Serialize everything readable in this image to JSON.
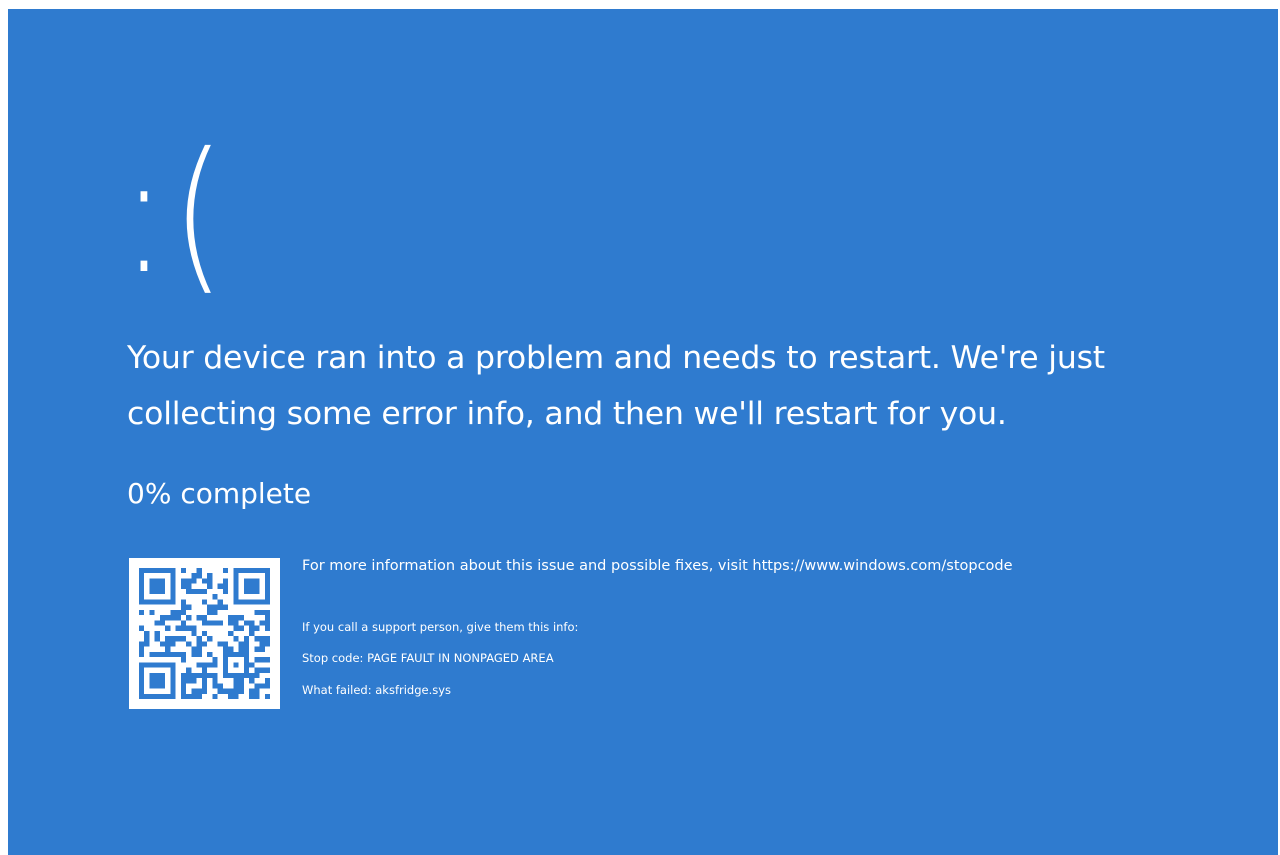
{
  "screen": {
    "background_color": "#2f7bcf",
    "text_color": "#ffffff",
    "sad_face": ":(",
    "message": "Your device ran into a problem and needs to restart. We're just collecting some error info, and then we'll restart for you.",
    "progress_text": "0% complete",
    "progress_percent": 0,
    "more_info_text": "For more information about this issue and possible fixes, visit https://www.windows.com/stopcode",
    "support_intro": "If you call a support person, give them this info:",
    "stop_code_text": "Stop code: PAGE FAULT IN NONPAGED AREA",
    "what_failed_text": "What failed: aksfridge.sys",
    "qr_code_icon": "qr-code-icon"
  }
}
